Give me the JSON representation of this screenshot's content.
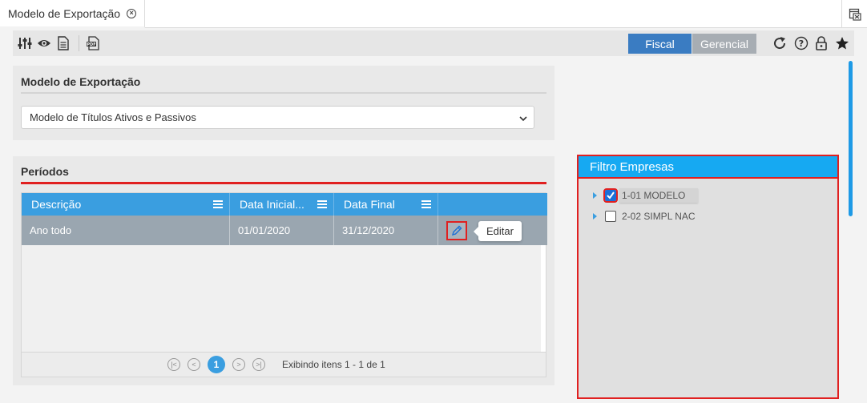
{
  "tab": {
    "title": "Modelo de Exportação"
  },
  "toolbar": {
    "fiscal_label": "Fiscal",
    "gerencial_label": "Gerencial"
  },
  "modelo": {
    "title": "Modelo de Exportação",
    "selected": "Modelo de Títulos Ativos e Passivos"
  },
  "periodos": {
    "title": "Períodos",
    "columns": [
      "Descrição",
      "Data Inicial...",
      "Data Final"
    ],
    "rows": [
      {
        "descricao": "Ano todo",
        "data_inicial": "01/01/2020",
        "data_final": "31/12/2020"
      }
    ],
    "edit_tooltip": "Editar",
    "pager": {
      "current_page": "1",
      "status": "Exibindo itens 1 - 1 de 1"
    }
  },
  "filtro": {
    "title": "Filtro Empresas",
    "items": [
      {
        "label": "1-01 MODELO",
        "checked": true
      },
      {
        "label": "2-02 SIMPL NAC",
        "checked": false
      }
    ]
  },
  "colors": {
    "accent_blue": "#3a7cc2",
    "grid_header": "#3a9ee0",
    "filtro_header": "#16a9f2",
    "highlight_red": "#e02020"
  }
}
